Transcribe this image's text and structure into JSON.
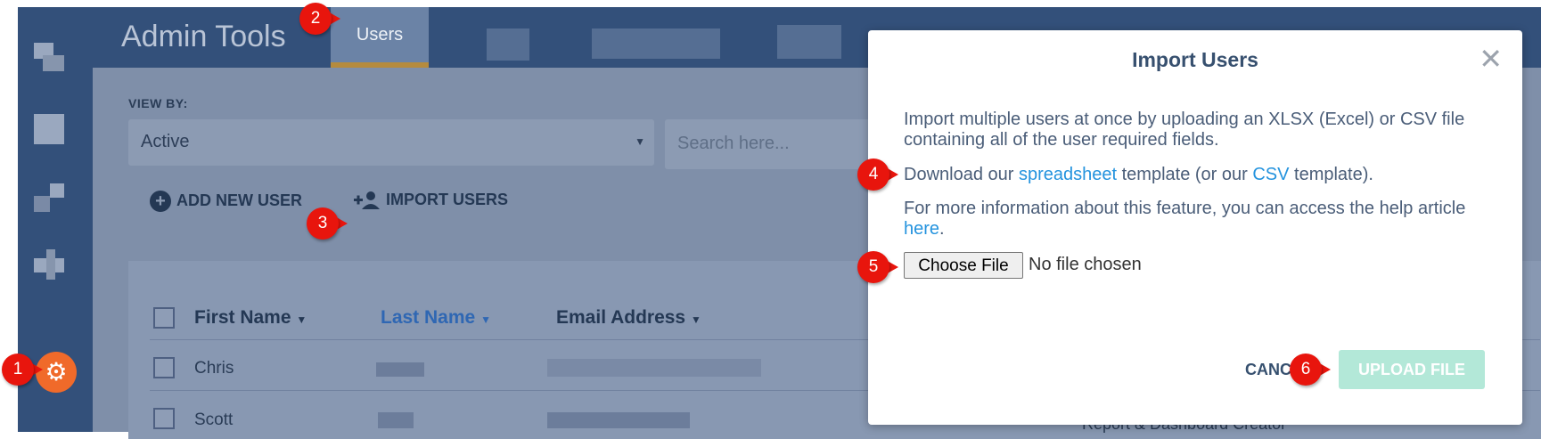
{
  "header": {
    "app_title": "Admin Tools",
    "active_tab": "Users"
  },
  "filters": {
    "view_by_label": "VIEW BY:",
    "view_by_value": "Active",
    "search_placeholder": "Search here..."
  },
  "actions": {
    "add_new_user_label": "ADD NEW USER",
    "import_users_label": "IMPORT USERS"
  },
  "table": {
    "columns": [
      "First Name",
      "Last Name",
      "Email Address"
    ],
    "rows": [
      {
        "first_name": "Chris"
      },
      {
        "first_name": "Scott"
      }
    ],
    "partial_cell_text": "Report & Dashboard Creator"
  },
  "modal": {
    "title": "Import Users",
    "paragraph1": "Import multiple users at once by uploading an XLSX (Excel) or CSV file containing all of the user required fields.",
    "p2_prefix": "Download our ",
    "p2_link1": "spreadsheet",
    "p2_middle": " template (or our ",
    "p2_link2": "CSV",
    "p2_suffix": " template).",
    "p3_prefix": "For more information about this feature, you can access the help article ",
    "p3_link": "here",
    "p3_suffix": ".",
    "choose_file_label": "Choose File",
    "file_status": "No file chosen",
    "cancel_label": "CANCEL",
    "upload_label": "UPLOAD FILE"
  },
  "steps": [
    "1",
    "2",
    "3",
    "4",
    "5",
    "6"
  ],
  "colors": {
    "nav_bg": "#33507a",
    "accent_link": "#2493de",
    "step_marker": "#e8150d",
    "settings_button": "#f06a2a",
    "upload_button_disabled": "#b3e8d8",
    "active_tab_underline": "#b58b3e"
  }
}
